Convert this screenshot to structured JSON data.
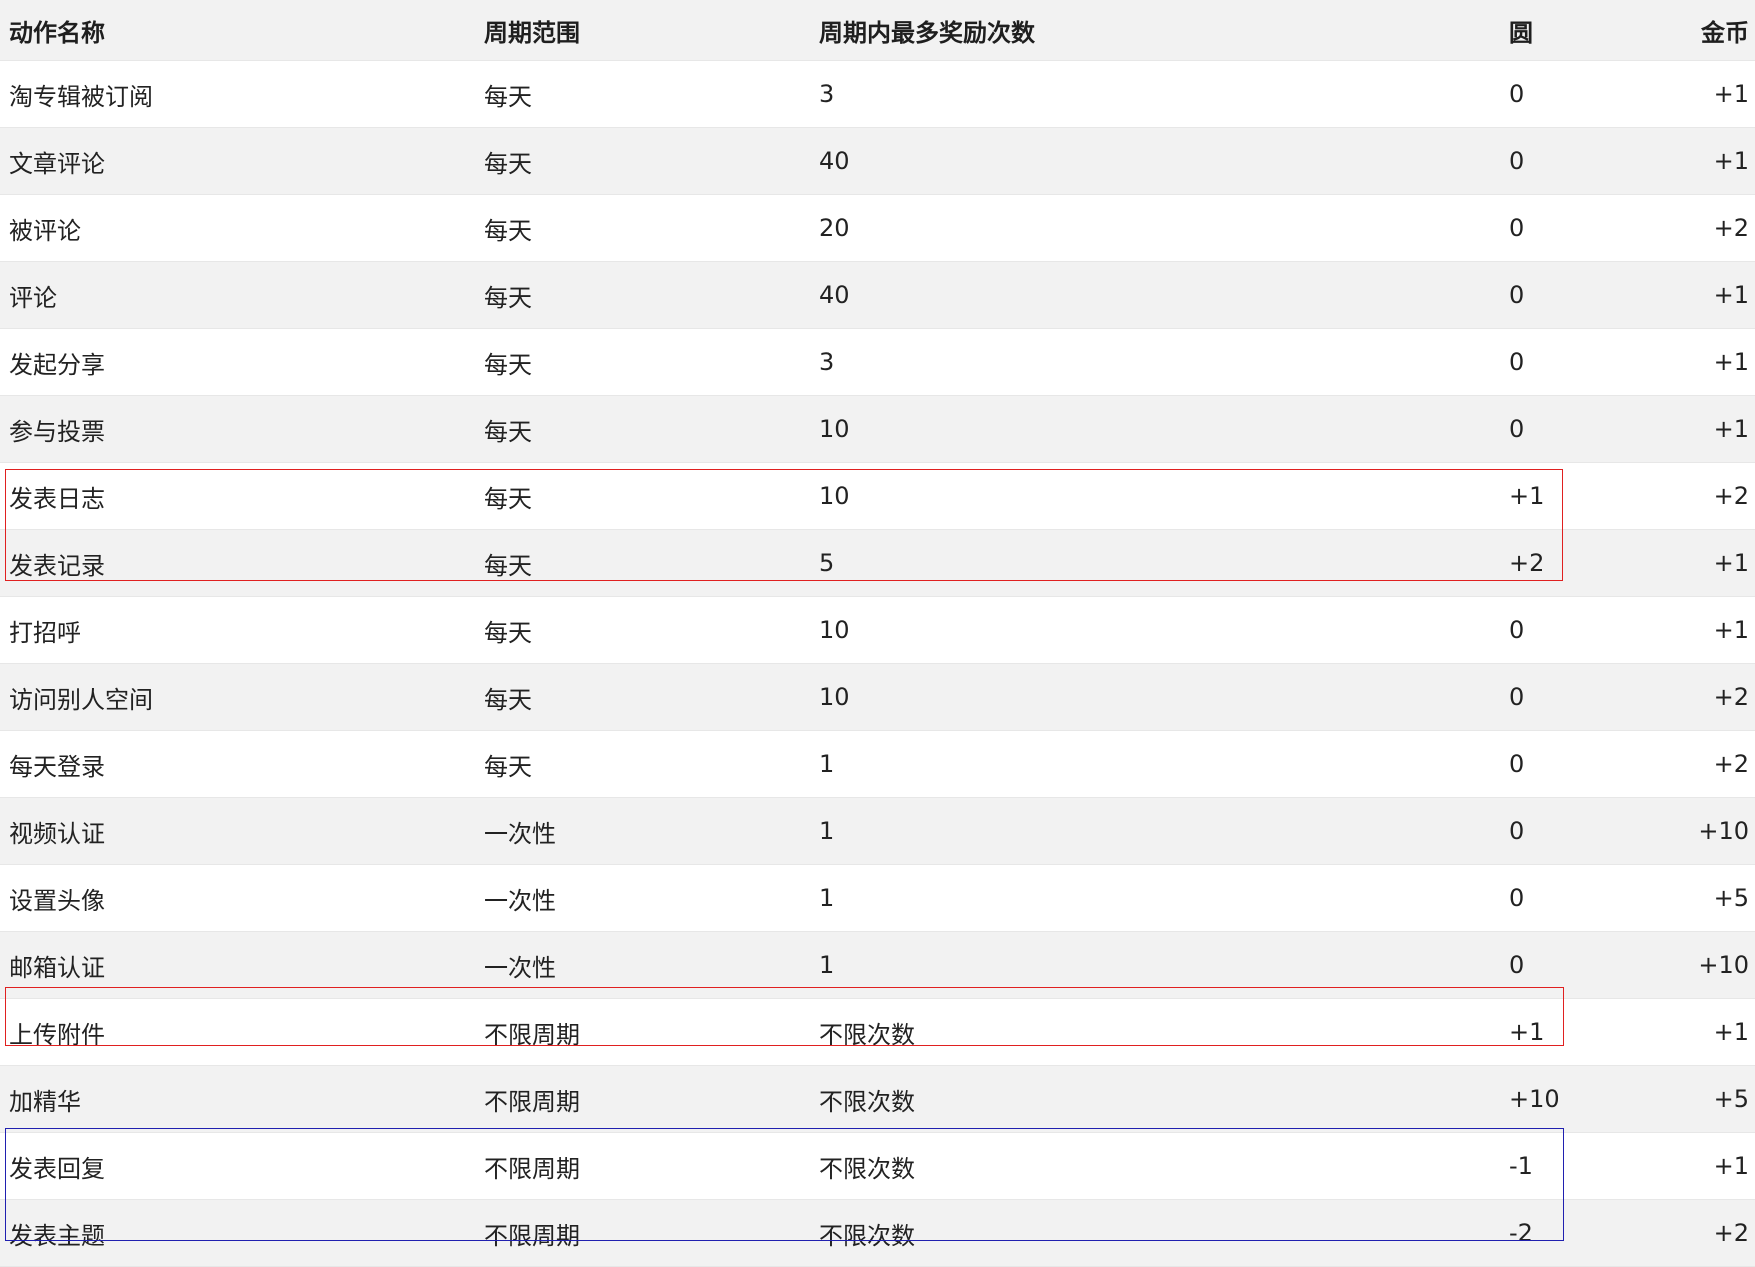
{
  "table": {
    "headers": [
      "动作名称",
      "周期范围",
      "周期内最多奖励次数",
      "圆",
      "金币"
    ],
    "rows": [
      [
        "淘专辑被订阅",
        "每天",
        "3",
        "0",
        "+1"
      ],
      [
        "文章评论",
        "每天",
        "40",
        "0",
        "+1"
      ],
      [
        "被评论",
        "每天",
        "20",
        "0",
        "+2"
      ],
      [
        "评论",
        "每天",
        "40",
        "0",
        "+1"
      ],
      [
        "发起分享",
        "每天",
        "3",
        "0",
        "+1"
      ],
      [
        "参与投票",
        "每天",
        "10",
        "0",
        "+1"
      ],
      [
        "发表日志",
        "每天",
        "10",
        "+1",
        "+2"
      ],
      [
        "发表记录",
        "每天",
        "5",
        "+2",
        "+1"
      ],
      [
        "打招呼",
        "每天",
        "10",
        "0",
        "+1"
      ],
      [
        "访问别人空间",
        "每天",
        "10",
        "0",
        "+2"
      ],
      [
        "每天登录",
        "每天",
        "1",
        "0",
        "+2"
      ],
      [
        "视频认证",
        "一次性",
        "1",
        "0",
        "+10"
      ],
      [
        "设置头像",
        "一次性",
        "1",
        "0",
        "+5"
      ],
      [
        "邮箱认证",
        "一次性",
        "1",
        "0",
        "+10"
      ],
      [
        "上传附件",
        "不限周期",
        "不限次数",
        "+1",
        "+1"
      ],
      [
        "加精华",
        "不限周期",
        "不限次数",
        "+10",
        "+5"
      ],
      [
        "发表回复",
        "不限周期",
        "不限次数",
        "-1",
        "+1"
      ],
      [
        "发表主题",
        "不限周期",
        "不限次数",
        "-2",
        "+2"
      ]
    ]
  },
  "highlight_colors": {
    "red": "#e02020",
    "blue": "#2020b0"
  }
}
